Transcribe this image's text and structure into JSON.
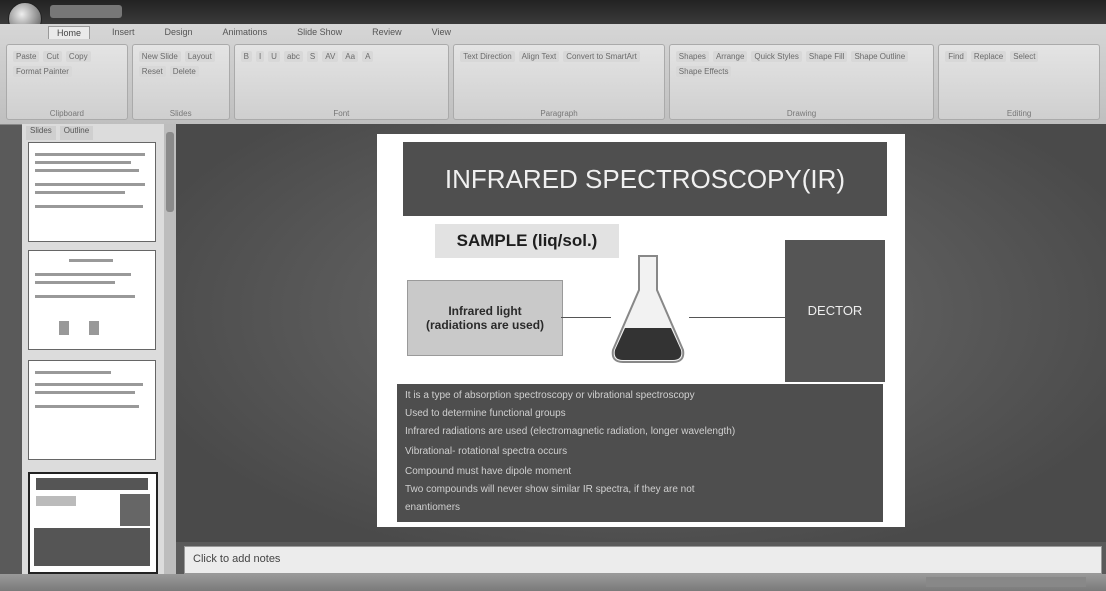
{
  "window": {
    "title": ""
  },
  "ribbon": {
    "tabs": [
      "Home",
      "Insert",
      "Design",
      "Animations",
      "Slide Show",
      "Review",
      "View"
    ],
    "groups": [
      {
        "label": "Clipboard",
        "buttons": [
          "Paste",
          "Cut",
          "Copy",
          "Format Painter"
        ]
      },
      {
        "label": "Slides",
        "buttons": [
          "New Slide",
          "Layout",
          "Reset",
          "Delete"
        ]
      },
      {
        "label": "Font",
        "buttons": [
          "B",
          "I",
          "U",
          "abc",
          "S",
          "AV",
          "Aa",
          "A"
        ]
      },
      {
        "label": "Paragraph",
        "buttons": [
          "Text Direction",
          "Align Text",
          "Convert to SmartArt"
        ]
      },
      {
        "label": "Drawing",
        "buttons": [
          "Shapes",
          "Arrange",
          "Quick Styles",
          "Shape Fill",
          "Shape Outline",
          "Shape Effects"
        ]
      },
      {
        "label": "Editing",
        "buttons": [
          "Find",
          "Replace",
          "Select"
        ]
      }
    ]
  },
  "slides_panel": {
    "tabs": [
      "Slides",
      "Outline"
    ],
    "numbers": [
      "",
      "",
      "",
      ""
    ]
  },
  "slide": {
    "title": "INFRARED SPECTROSCOPY(IR)",
    "sample_label": "SAMPLE (liq/sol.)",
    "light_box": "Infrared light\n(radiations are used)",
    "detector": "DECTOR",
    "bullets": [
      "It is a type of absorption spectroscopy or vibrational spectroscopy",
      "Used to determine functional groups",
      "Infrared  radiations are used (electromagnetic radiation, longer wavelength)",
      "Vibrational- rotational spectra occurs",
      "Compound must have dipole moment",
      "Two compounds will never show similar IR spectra, if they are not",
      "enantiomers"
    ]
  },
  "notes": {
    "placeholder": "Click to add notes"
  },
  "status": {
    "left": ""
  }
}
